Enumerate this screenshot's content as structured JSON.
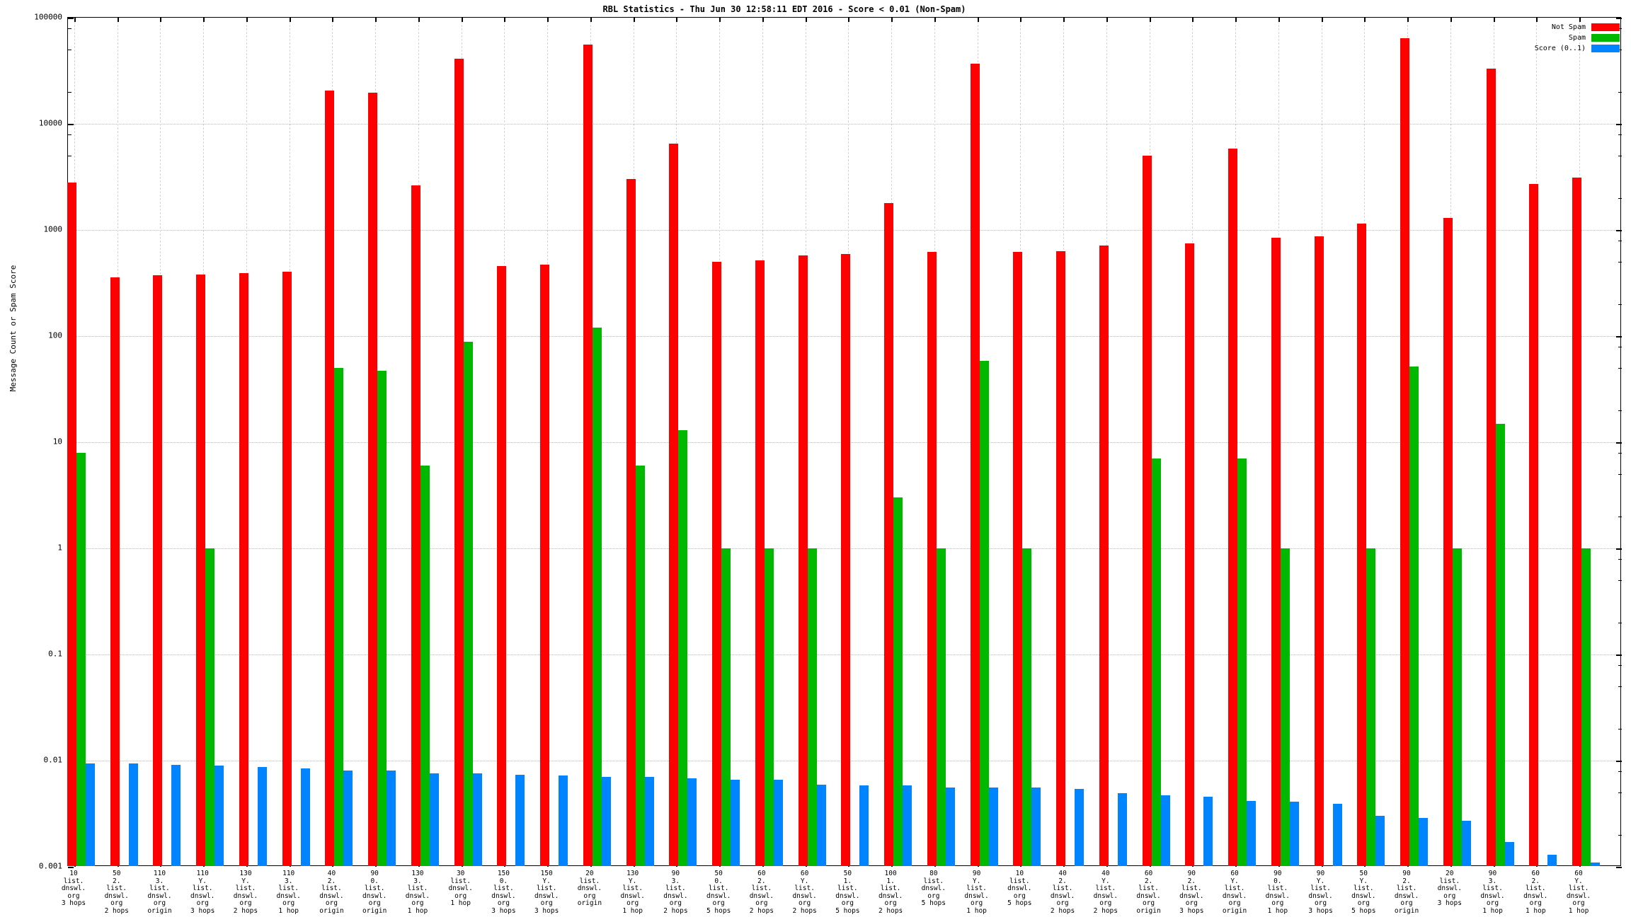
{
  "title": "RBL Statistics - Thu Jun 30 12:58:11 EDT 2016 - Score < 0.01 (Non-Spam)",
  "ylabel": "Message Count or Spam Score",
  "legend": [
    {
      "label": "Not Spam",
      "color": "#ff0000"
    },
    {
      "label": "Spam",
      "color": "#00b800"
    },
    {
      "label": "Score (0..1)",
      "color": "#0084ff"
    }
  ],
  "chart_data": {
    "type": "bar",
    "yscale": "log",
    "ylim": [
      0.001,
      100000
    ],
    "ytick_labels": [
      "100000",
      "10000",
      "1000",
      "100",
      "10",
      "1",
      "0.1",
      "0.01",
      "0.001"
    ],
    "grid": true,
    "legend_position": "top-right",
    "categories": [
      "10\nlist.\ndnswl.\norg\n3 hops",
      "50\n2.\nlist.\ndnswl.\norg\n2 hops",
      "110\n3.\nlist.\ndnswl.\norg\norigin",
      "110\nY.\nlist.\ndnswl.\norg\n3 hops",
      "130\nY.\nlist.\ndnswl.\norg\n2 hops",
      "110\n3.\nlist.\ndnswl.\norg\n1 hop",
      "40\n2.\nlist.\ndnswl.\norg\norigin",
      "90\n0.\nlist.\ndnswl.\norg\norigin",
      "130\n3.\nlist.\ndnswl.\norg\n1 hop",
      "30\nlist.\ndnswl.\norg\n1 hop",
      "150\n0.\nlist.\ndnswl.\norg\n3 hops",
      "150\nY.\nlist.\ndnswl.\norg\n3 hops",
      "20\nlist.\ndnswl.\norg\norigin",
      "130\nY.\nlist.\ndnswl.\norg\n1 hop",
      "90\n3.\nlist.\ndnswl.\norg\n2 hops",
      "50\n0.\nlist.\ndnswl.\norg\n5 hops",
      "60\n2.\nlist.\ndnswl.\norg\n2 hops",
      "60\nY.\nlist.\ndnswl.\norg\n2 hops",
      "50\n1.\nlist.\ndnswl.\norg\n5 hops",
      "100\n1.\nlist.\ndnswl.\norg\n2 hops",
      "80\nlist.\ndnswl.\norg\n5 hops",
      "90\nY.\nlist.\ndnswl.\norg\n1 hop",
      "10\nlist.\ndnswl.\norg\n5 hops",
      "40\n2.\nlist.\ndnswl.\norg\n2 hops",
      "40\nY.\nlist.\ndnswl.\norg\n2 hops",
      "60\n2.\nlist.\ndnswl.\norg\norigin",
      "90\n2.\nlist.\ndnswl.\norg\n3 hops",
      "60\nY.\nlist.\ndnswl.\norg\norigin",
      "90\n0.\nlist.\ndnswl.\norg\n1 hop",
      "90\nY.\nlist.\ndnswl.\norg\n3 hops",
      "50\nY.\nlist.\ndnswl.\norg\n5 hops",
      "90\n2.\nlist.\ndnswl.\norg\norigin",
      "20\nlist.\ndnswl.\norg\n3 hops",
      "90\n3.\nlist.\ndnswl.\norg\n1 hop",
      "60\n2.\nlist.\ndnswl.\norg\n1 hop",
      "60\nY.\nlist.\ndnswl.\norg\n1 hop"
    ],
    "series": [
      {
        "name": "Not Spam",
        "color": "#ff0000",
        "values": [
          2800,
          360,
          375,
          380,
          395,
          405,
          20500,
          19700,
          2650,
          41000,
          455,
          470,
          56000,
          3000,
          6500,
          505,
          515,
          575,
          595,
          1800,
          625,
          37000,
          620,
          635,
          715,
          5000,
          750,
          5800,
          850,
          875,
          1150,
          64000,
          1300,
          33000,
          2700,
          3100
        ]
      },
      {
        "name": "Spam",
        "color": "#00b800",
        "values": [
          8,
          0,
          0,
          1,
          0,
          0,
          50,
          47,
          6,
          88,
          0,
          0,
          120,
          6,
          13,
          1,
          1,
          1,
          0,
          3,
          1,
          58,
          1,
          0,
          0,
          7,
          0,
          7,
          1,
          0,
          1,
          52,
          1,
          15,
          0,
          1
        ]
      },
      {
        "name": "Score (0..1)",
        "color": "#0084ff",
        "values": [
          0.0094,
          0.0094,
          0.0091,
          0.009,
          0.0087,
          0.0084,
          0.0081,
          0.0081,
          0.0076,
          0.0076,
          0.0074,
          0.0073,
          0.007,
          0.007,
          0.0068,
          0.0066,
          0.0066,
          0.0059,
          0.0058,
          0.0058,
          0.0056,
          0.0056,
          0.0056,
          0.0054,
          0.0049,
          0.0047,
          0.0046,
          0.0042,
          0.0041,
          0.0039,
          0.003,
          0.0029,
          0.0027,
          0.0017,
          0.0013,
          0.0011
        ]
      }
    ]
  }
}
